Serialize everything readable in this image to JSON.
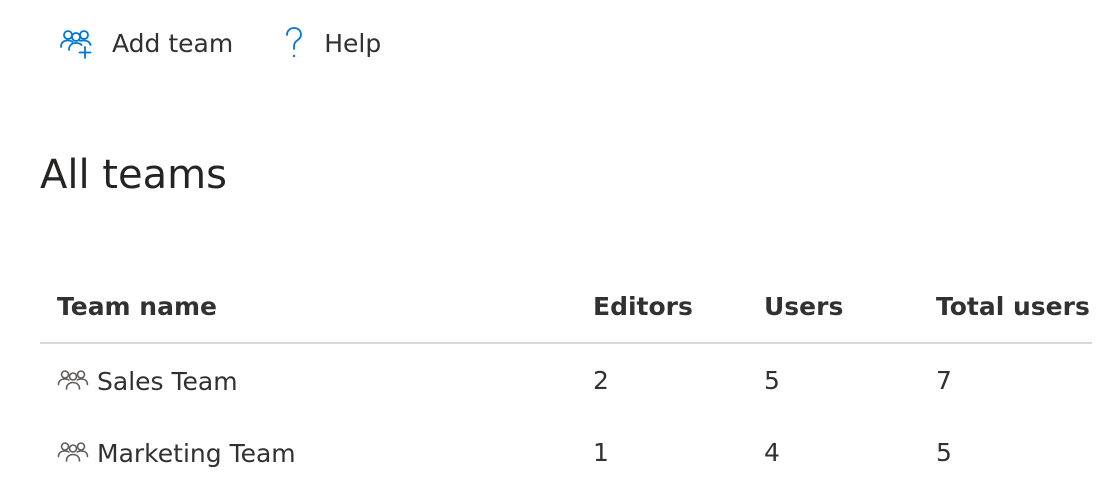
{
  "command_bar": {
    "add_team": {
      "label": "Add team",
      "icon": "add-team-icon"
    },
    "help": {
      "label": "Help",
      "icon": "help-icon"
    }
  },
  "page": {
    "title": "All teams"
  },
  "table": {
    "columns": [
      "Team name",
      "Editors",
      "Users",
      "Total users"
    ],
    "rows": [
      {
        "name": "Sales Team",
        "icon": "team-icon",
        "editors": "2",
        "users": "5",
        "total_users": "7"
      },
      {
        "name": "Marketing Team",
        "icon": "team-icon",
        "editors": "1",
        "users": "4",
        "total_users": "5"
      }
    ]
  },
  "colors": {
    "accent": "#0078d4",
    "text": "#323130",
    "divider": "#d8d8d8",
    "team_icon": "#605e5c"
  }
}
